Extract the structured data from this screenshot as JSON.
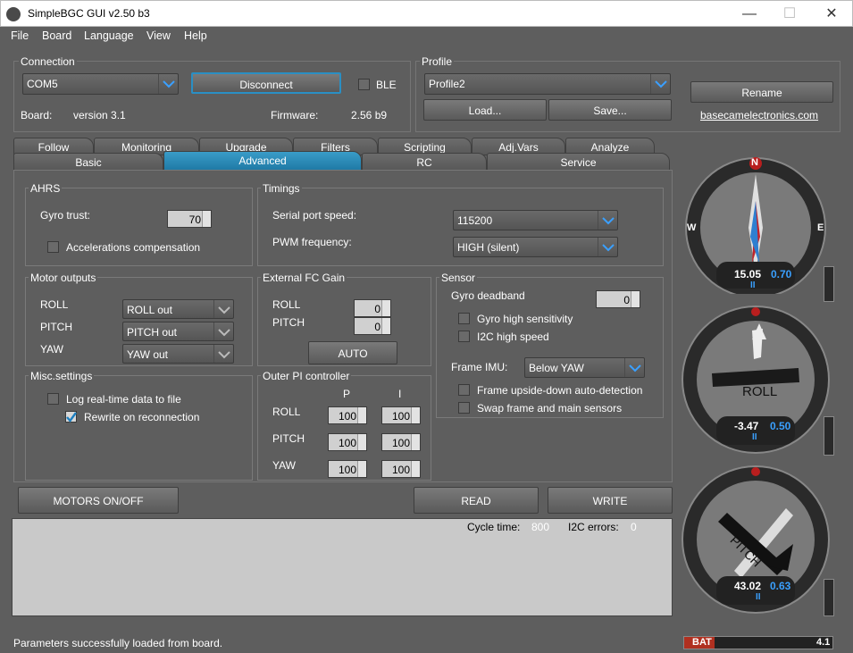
{
  "window": {
    "title": "SimpleBGC GUI v2.50 b3",
    "min_glyph": "—",
    "max_glyph": "☐",
    "close_glyph": "✕"
  },
  "menu": [
    "File",
    "Board",
    "Language",
    "View",
    "Help"
  ],
  "connection": {
    "title": "Connection",
    "port": "COM5",
    "disconnect_label": "Disconnect",
    "ble_label": "BLE",
    "board_label": "Board:",
    "board_value": "version 3.1",
    "firmware_label": "Firmware:",
    "firmware_value": "2.56 b9"
  },
  "profile": {
    "title": "Profile",
    "selected": "Profile2",
    "load_label": "Load...",
    "save_label": "Save...",
    "rename_label": "Rename",
    "link": "basecamelectronics.com"
  },
  "tabs_row1": [
    "Follow",
    "Monitoring",
    "Upgrade",
    "Filters",
    "Scripting",
    "Adj.Vars",
    "Analyze"
  ],
  "tabs_row2": [
    "Basic",
    "Advanced",
    "RC",
    "Service"
  ],
  "ahrs": {
    "title": "AHRS",
    "gyro_trust_label": "Gyro trust:",
    "gyro_trust": "70",
    "acc_comp_label": "Accelerations compensation"
  },
  "timings": {
    "title": "Timings",
    "serial_label": "Serial port speed:",
    "serial_value": "115200",
    "pwm_label": "PWM frequency:",
    "pwm_value": "HIGH (silent)"
  },
  "motor_outputs": {
    "title": "Motor outputs",
    "rows": [
      {
        "axis": "ROLL",
        "value": "ROLL out"
      },
      {
        "axis": "PITCH",
        "value": "PITCH out"
      },
      {
        "axis": "YAW",
        "value": "YAW out"
      }
    ]
  },
  "ext_fc": {
    "title": "External FC Gain",
    "roll_label": "ROLL",
    "roll_value": "0",
    "pitch_label": "PITCH",
    "pitch_value": "0",
    "auto_label": "AUTO"
  },
  "sensor": {
    "title": "Sensor",
    "deadband_label": "Gyro deadband",
    "deadband_value": "0",
    "gyro_high_label": "Gyro high sensitivity",
    "i2c_label": "I2C high speed",
    "frame_imu_label": "Frame IMU:",
    "frame_imu_value": "Below YAW",
    "upside_label": "Frame upside-down auto-detection",
    "swap_label": "Swap frame and main sensors"
  },
  "misc": {
    "title": "Misc.settings",
    "log_label": "Log real-time data to file",
    "log_checked": false,
    "rewrite_label": "Rewrite on reconnection",
    "rewrite_checked": true
  },
  "outer_pi": {
    "title": "Outer PI controller",
    "p_header": "P",
    "i_header": "I",
    "rows": [
      {
        "axis": "ROLL",
        "p": "100",
        "i": "100"
      },
      {
        "axis": "PITCH",
        "p": "100",
        "i": "100"
      },
      {
        "axis": "YAW",
        "p": "100",
        "i": "100"
      }
    ]
  },
  "actions": {
    "motors_label": "MOTORS ON/OFF",
    "read_label": "READ",
    "write_label": "WRITE"
  },
  "log": {
    "cycle_label": "Cycle time:",
    "cycle_value": "800",
    "i2c_label": "I2C errors:",
    "i2c_value": "0"
  },
  "status": {
    "message": "Parameters successfully loaded from board.",
    "bat_label": "BAT",
    "bat_value": "4.1"
  },
  "gauges": {
    "yaw": {
      "angle": "15.05",
      "rate": "0.70",
      "n": "N",
      "w": "W",
      "e": "E",
      "ii": "II"
    },
    "roll": {
      "label": "ROLL",
      "angle": "-3.47",
      "rate": "0.50",
      "ii": "II"
    },
    "pitch": {
      "label": "PITCH",
      "angle": "43.02",
      "rate": "0.63",
      "ii": "II"
    }
  },
  "colors": {
    "accent": "#1f8ac0",
    "rate": "#3aa0ff",
    "bat_red": "#b03020"
  }
}
